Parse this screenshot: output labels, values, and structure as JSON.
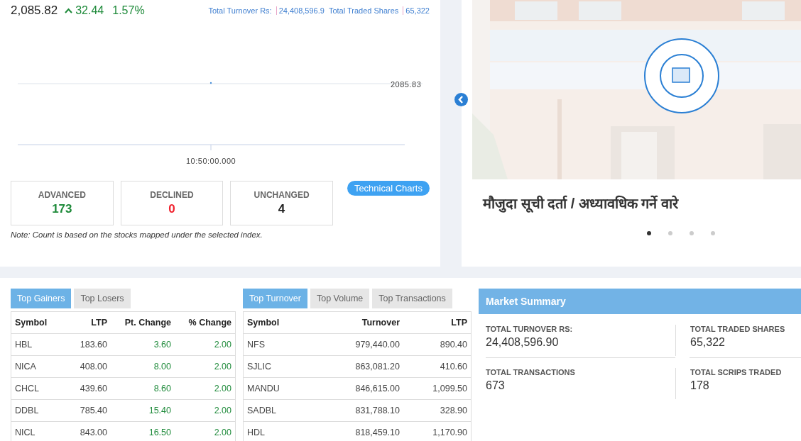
{
  "index_header": {
    "value": "2,085.82",
    "change": "32.44",
    "percent": "1.57%",
    "rising": true,
    "turnover_label": "Total Turnover Rs:",
    "turnover_value": "24,408,596.9",
    "shares_label": "Total Traded Shares",
    "shares_value": "65,322"
  },
  "index_chart": {
    "y_tick_label": "2085.83",
    "x_tick_label": "10:50:00.000"
  },
  "breadth": [
    {
      "kind": "advanced",
      "label": "ADVANCED",
      "count": "173"
    },
    {
      "kind": "declined",
      "label": "DECLINED",
      "count": "0"
    },
    {
      "kind": "unchanged",
      "label": "UNCHANGED",
      "count": "4"
    }
  ],
  "technical_charts_button": "Technical Charts",
  "note": "Note: Count is based on the stocks mapped under the selected index.",
  "banner": {
    "caption": "मौजुदा सूची दर्ता / अध्यावधिक गर्ने वारे",
    "dots": [
      {
        "selected": true
      },
      {
        "selected": false
      },
      {
        "selected": false
      },
      {
        "selected": false
      }
    ]
  },
  "gainers": {
    "tabs": [
      {
        "label": "Top Gainers",
        "selected": true
      },
      {
        "label": "Top Losers",
        "selected": false
      }
    ],
    "columns": [
      {
        "label": "Symbol",
        "kind": "text"
      },
      {
        "label": "LTP",
        "kind": "number"
      },
      {
        "label": "Pt. Change",
        "kind": "change"
      },
      {
        "label": "% Change",
        "kind": "change"
      }
    ],
    "rows": [
      [
        "HBL",
        "183.60",
        "3.60",
        "2.00"
      ],
      [
        "NICA",
        "408.00",
        "8.00",
        "2.00"
      ],
      [
        "CHCL",
        "439.60",
        "8.60",
        "2.00"
      ],
      [
        "DDBL",
        "785.40",
        "15.40",
        "2.00"
      ],
      [
        "NICL",
        "843.00",
        "16.50",
        "2.00"
      ]
    ]
  },
  "turnover": {
    "tabs": [
      {
        "label": "Top Turnover",
        "selected": true
      },
      {
        "label": "Top Volume",
        "selected": false
      },
      {
        "label": "Top Transactions",
        "selected": false
      }
    ],
    "columns": [
      {
        "label": "Symbol",
        "kind": "text"
      },
      {
        "label": "Turnover",
        "kind": "number"
      },
      {
        "label": "LTP",
        "kind": "number"
      }
    ],
    "rows": [
      [
        "NFS",
        "979,440.00",
        "890.40"
      ],
      [
        "SJLIC",
        "863,081.20",
        "410.60"
      ],
      [
        "MANDU",
        "846,615.00",
        "1,099.50"
      ],
      [
        "SADBL",
        "831,788.10",
        "328.90"
      ],
      [
        "HDL",
        "818,459.10",
        "1,170.90"
      ]
    ]
  },
  "market_summary": {
    "title": "Market Summary",
    "items": [
      {
        "label": "TOTAL TURNOVER RS:",
        "value": "24,408,596.90"
      },
      {
        "label": "TOTAL TRADED SHARES",
        "value": "65,322"
      },
      {
        "label": "TOTAL TRANSACTIONS",
        "value": "673"
      },
      {
        "label": "TOTAL SCRIPS TRADED",
        "value": "178"
      }
    ]
  }
}
